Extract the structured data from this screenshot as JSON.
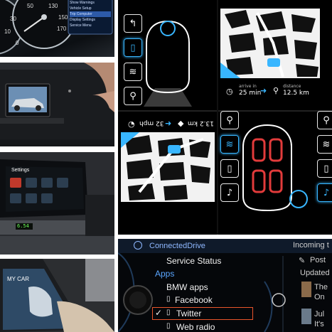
{
  "gauges": {
    "speed_ticks": [
      "50",
      "30",
      "130",
      "150",
      "170",
      "10",
      "0"
    ],
    "menu_items": [
      "Show Warnings",
      "Vehicle Setup",
      "Trip Computer",
      "Display Settings",
      "Service Menu"
    ]
  },
  "settings_screen": {
    "title": "Settings",
    "lcd_value": "6.54"
  },
  "mycar_screen": {
    "title": "MY CAR"
  },
  "concept_ui": {
    "arrive_label": "arrive in",
    "arrive_value": "25 min",
    "distance_label": "distance",
    "distance_value": "12.5 km",
    "speed_value": "32 mph",
    "range_value": "13.2 km",
    "accent_color": "#38b6ff"
  },
  "connected_drive": {
    "title": "ConnectedDrive",
    "service_status": "Service Status",
    "apps_heading": "Apps",
    "items": [
      {
        "label": "BMW apps"
      },
      {
        "label": "Facebook"
      },
      {
        "label": "Twitter"
      },
      {
        "label": "Web radio"
      }
    ],
    "right_title": "Incoming t",
    "right_post": "Post",
    "right_updated": "Updated",
    "right_name_1": "The",
    "right_text_1": "On",
    "right_name_2": "Jul",
    "right_text_2": "It's",
    "selected_color": "#e8542b"
  }
}
